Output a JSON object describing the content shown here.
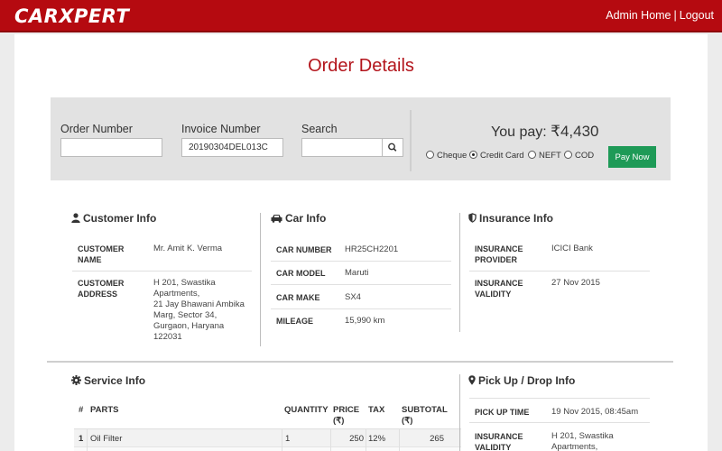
{
  "app": {
    "logo_text": "CARXPERT",
    "nav": {
      "home": "Admin Home",
      "separator": "|",
      "logout": "Logout"
    },
    "brand_color": "#b50a10",
    "accent_color": "#1e9a57"
  },
  "page": {
    "title": "Order Details"
  },
  "order_bar": {
    "order_number_label": "Order Number",
    "order_number_value": "",
    "invoice_number_label": "Invoice Number",
    "invoice_number_value": "20190304DEL013C",
    "search_label": "Search",
    "search_value": "",
    "you_pay_label": "You pay:",
    "you_pay_amount": "₹4,430",
    "payment_options": [
      {
        "label": "Cheque",
        "selected": false
      },
      {
        "label": "Credit Card",
        "selected": true
      },
      {
        "label": "NEFT",
        "selected": false
      },
      {
        "label": "COD",
        "selected": false
      }
    ],
    "pay_now_label": "Pay Now"
  },
  "customer_info": {
    "title": "Customer Info",
    "icon": "user-icon",
    "name_key_1": "CUSTOMER",
    "name_key_2": "NAME",
    "name_value": "Mr. Amit K. Verma",
    "address_key_1": "CUSTOMER",
    "address_key_2": "ADDRESS",
    "address_lines": [
      "H 201, Swastika",
      "Apartments,",
      "21 Jay Bhawani Ambika",
      "Marg, Sector 34,",
      "Gurgaon, Haryana",
      "122031"
    ]
  },
  "car_info": {
    "title": "Car Info",
    "icon": "car-icon",
    "rows": [
      {
        "key": "CAR NUMBER",
        "value": "HR25CH2201"
      },
      {
        "key": "CAR MODEL",
        "value": "Maruti"
      },
      {
        "key": "CAR MAKE",
        "value": "SX4"
      },
      {
        "key": "MILEAGE",
        "value": "15,990 km"
      }
    ]
  },
  "insurance_info": {
    "title": "Insurance Info",
    "icon": "shield-icon",
    "provider_key_1": "INSURANCE",
    "provider_key_2": "PROVIDER",
    "provider_value": "ICICI Bank",
    "validity_key_1": "INSURANCE",
    "validity_key_2": "VALIDITY",
    "validity_value": "27 Nov 2015"
  },
  "service_info": {
    "title": "Service Info",
    "icon": "gear-icon",
    "headers": {
      "num": "#",
      "parts": "PARTS",
      "quantity": "QUANTITY",
      "price_1": "PRICE",
      "price_2": "(₹)",
      "tax": "TAX",
      "subtotal_1": "SUBTOTAL",
      "subtotal_2": "(₹)"
    },
    "rows": [
      {
        "num": "1",
        "part": "Oil Filter",
        "quantity": "1",
        "price": "250",
        "tax": "12%",
        "subtotal": "265"
      }
    ]
  },
  "pickup_info": {
    "title": "Pick Up / Drop Info",
    "icon": "map-pin-icon",
    "pickup_key": "PICK UP TIME",
    "pickup_value": "19 Nov 2015, 08:45am",
    "validity_key_1": "INSURANCE",
    "validity_key_2": "VALIDITY",
    "validity_value_1": "H 201, Swastika",
    "validity_value_2": "Apartments,"
  }
}
